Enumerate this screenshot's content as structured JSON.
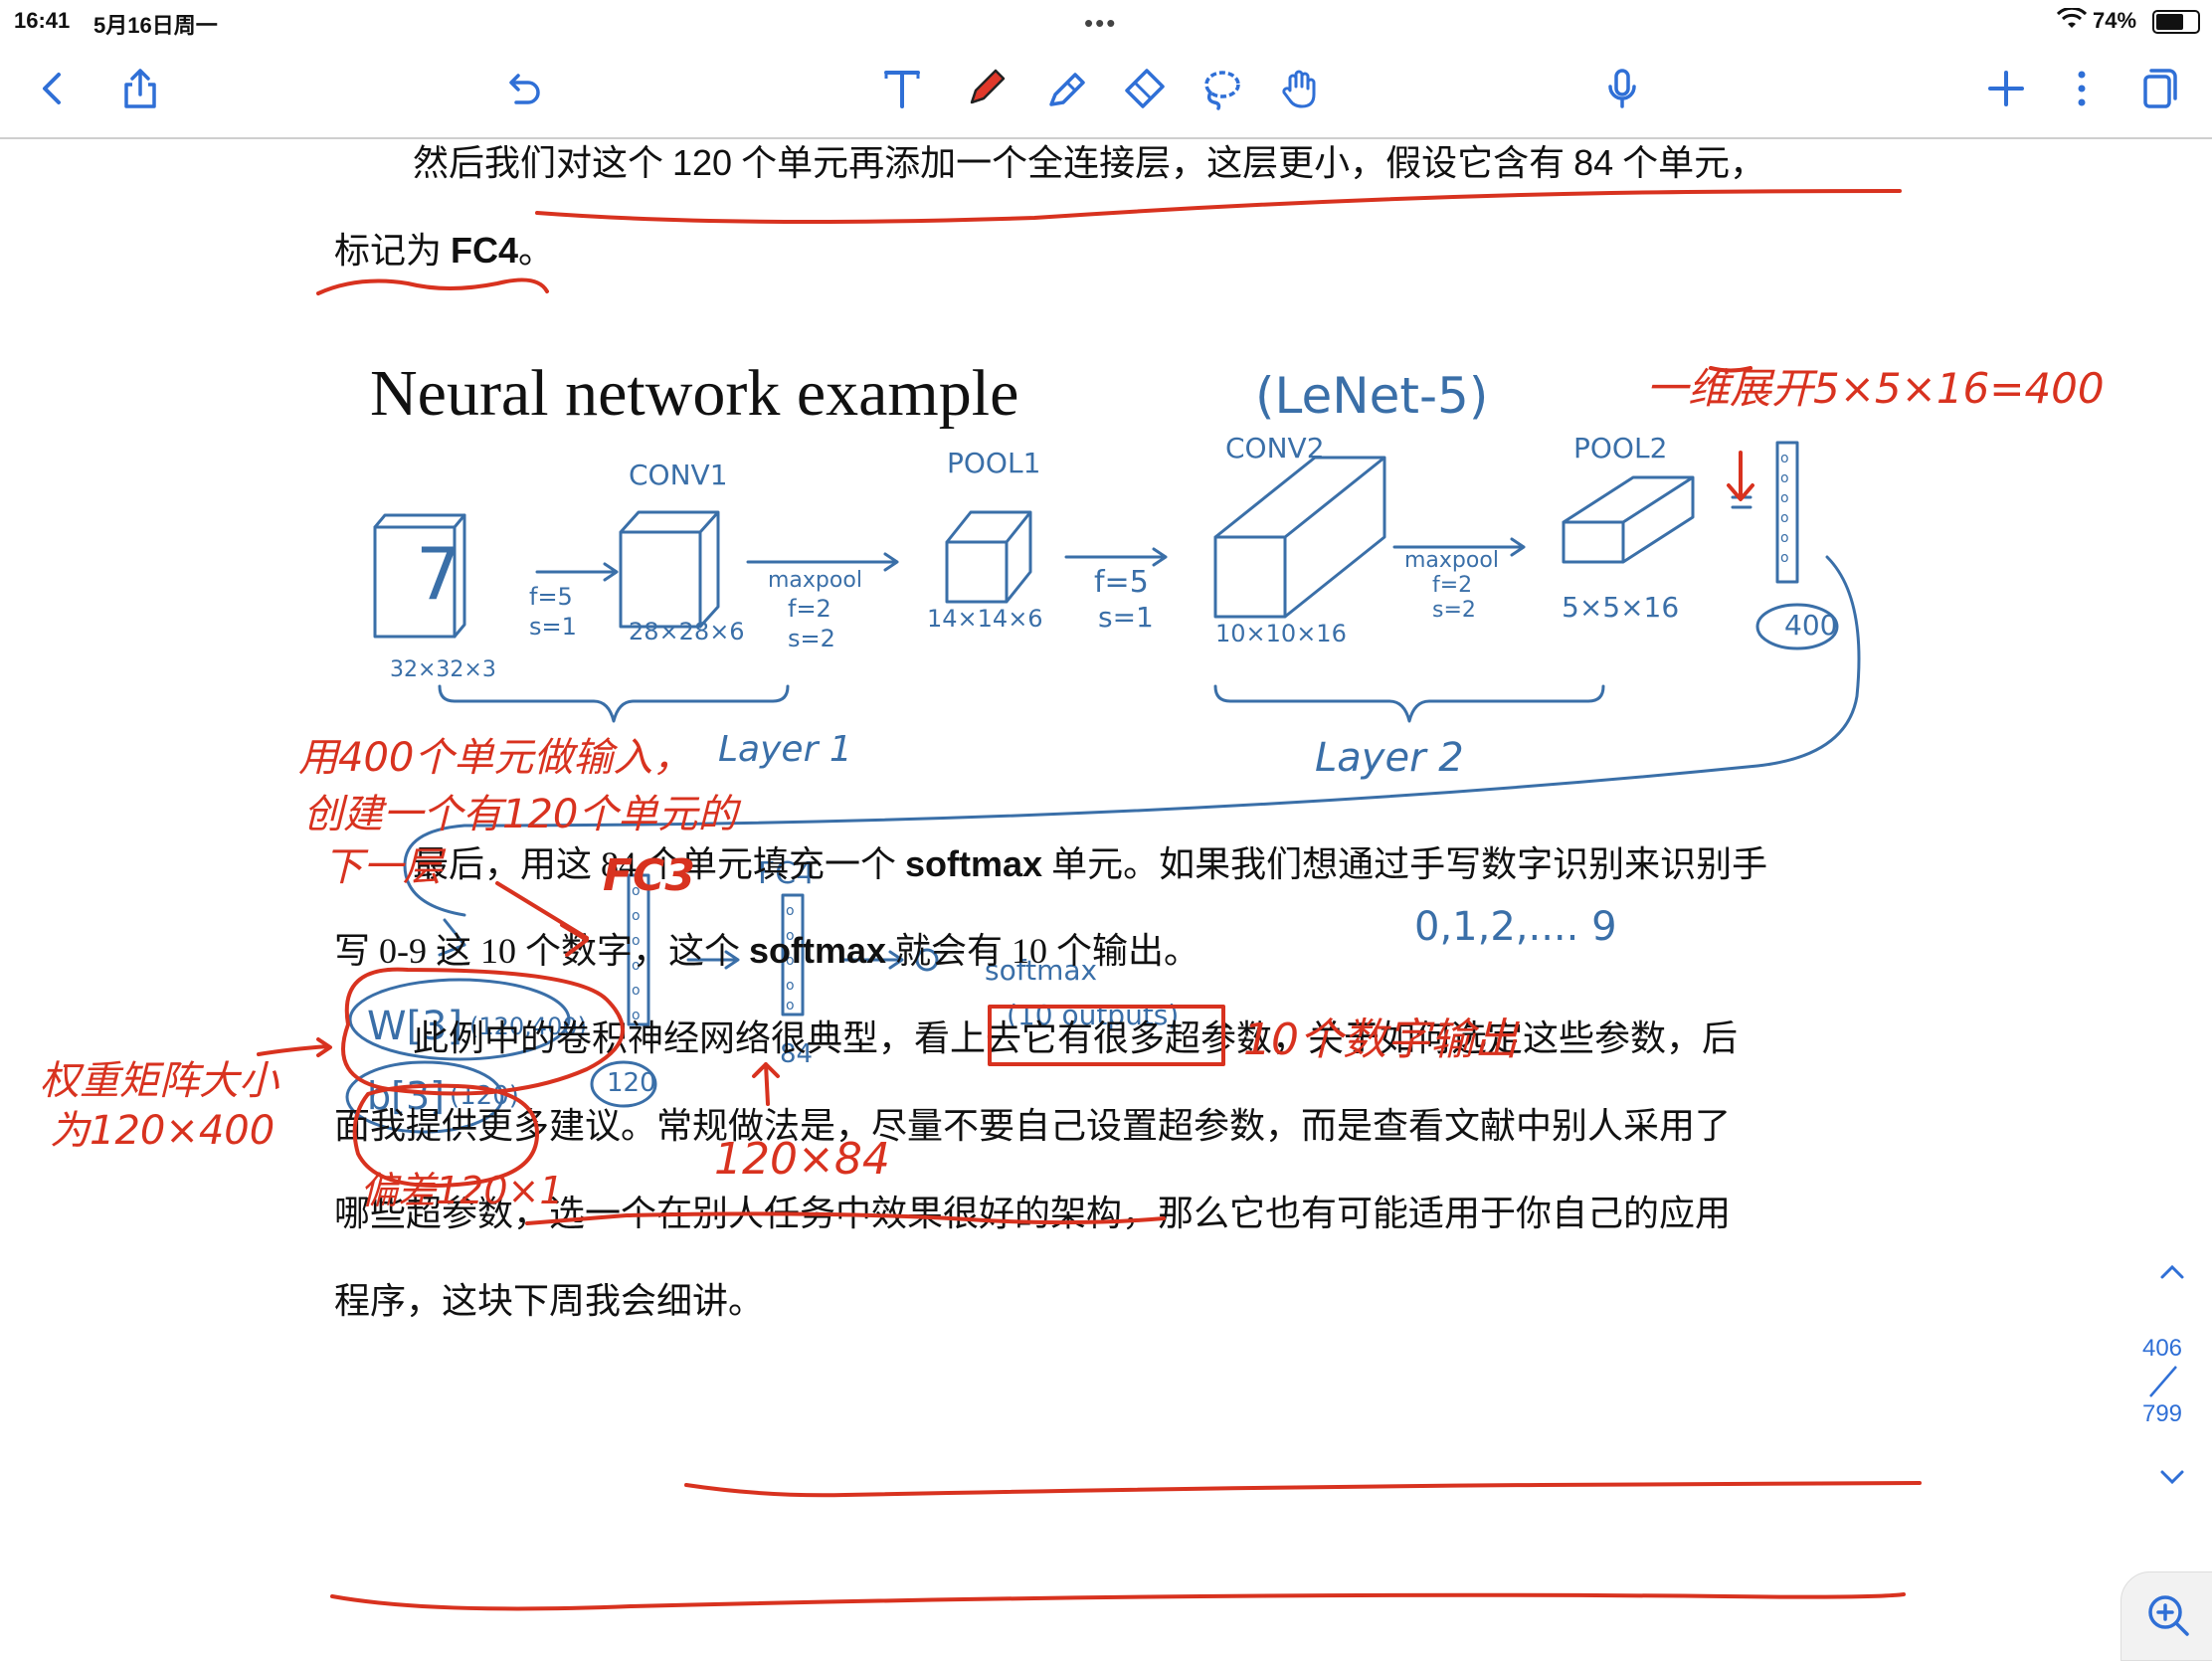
{
  "status_bar": {
    "time": "16:41",
    "date": "5月16日周一",
    "dots": "•••",
    "battery_percent": "74%",
    "battery_level": 0.74
  },
  "toolbar": {
    "icons": [
      "back-icon",
      "share-icon",
      "undo-icon",
      "text-tool-icon",
      "pen-icon",
      "highlighter-icon",
      "eraser-icon",
      "lasso-icon",
      "hand-icon",
      "microphone-icon",
      "add-icon",
      "more-icon",
      "pages-icon"
    ],
    "accent_color": "#2f6fd6",
    "pen_color": "#e0382a"
  },
  "document": {
    "p1_line1_a": "然后我们对这个 ",
    "p1_line1_num": "120",
    "p1_line1_b": " 个单元再添加一个全连接层，这层更小，假设它含有 ",
    "p1_line1_num2": "84",
    "p1_line1_c": " 个单元，",
    "p1_line2_a": "标记为 ",
    "p1_line2_bold": "FC4",
    "p1_line2_b": "。",
    "p2_line1_a": "最后，用这 84 个单元填充一个 ",
    "p2_line1_bold": "softmax",
    "p2_line1_b": " 单元。如果我们想通过手写数字识别来识别手",
    "p2_line2_a": "写 0-9 这 10 个数字，这个 ",
    "p2_line2_bold": "softmax",
    "p2_line2_b": " 就会有 10 个输出。",
    "p3_line1": "此例中的卷积神经网络很典型，看上去它有很多超参数，关于如何选定这些参数，后",
    "p3_line2": "面我提供更多建议。常规做法是，尽量不要自己设置超参数，而是查看文献中别人采用了",
    "p3_line3": "哪些超参数，选一个在别人任务中效果很好的架构，那么它也有可能适用于你自己的应用",
    "p3_line4": "程序，这块下周我会细讲。"
  },
  "figure": {
    "title": "Neural network example",
    "subtitle": "(LeNet-5)",
    "labels": {
      "conv1": "CONV1",
      "pool1": "POOL1",
      "conv2": "CONV2",
      "pool2": "POOL2",
      "input_digit": "7",
      "input_size": "32×32×3",
      "f5s1_a": "f=5",
      "s1_a": "s=1",
      "conv1_size": "28×28×6",
      "maxpool_a": "maxpool",
      "f2_a": "f=2",
      "s2_a": "s=2",
      "pool1_size": "14×14×6",
      "f5s1_b": "f=5",
      "s1_b": "s=1",
      "conv2_size": "10×10×16",
      "maxpool_b": "maxpool",
      "f2_b": "f=2",
      "s2_b": "s=2",
      "pool2_size": "5×5×16",
      "flat_count": "400",
      "layer1": "Layer 1",
      "layer2": "Layer 2",
      "fc3": "FC3",
      "fc4": "FC4",
      "softmax": "softmax",
      "ten_outputs": "(10 outputs)",
      "digits": "0,1,2,.... 9",
      "w3": "W[3]",
      "w3_shape": "(120,400)",
      "b3": "b[3]",
      "b3_shape": "(120)",
      "fc3_count": "120",
      "fc4_count": "84"
    }
  },
  "annotations": {
    "flatten_note": "一维展开5×5×16=400",
    "input_note_1": "用400个单元做输入，",
    "input_note_2": "创建一个有120个单元的",
    "input_note_3": "下一层",
    "fc3_note": "FC3",
    "weight_note_1": "权重矩阵大小",
    "weight_note_2": "为120×400",
    "bias_note": "偏差120×1",
    "fc4_weight_note": "120×84",
    "output_note": "10个数字输出"
  },
  "pager": {
    "current": "406",
    "total": "799"
  }
}
